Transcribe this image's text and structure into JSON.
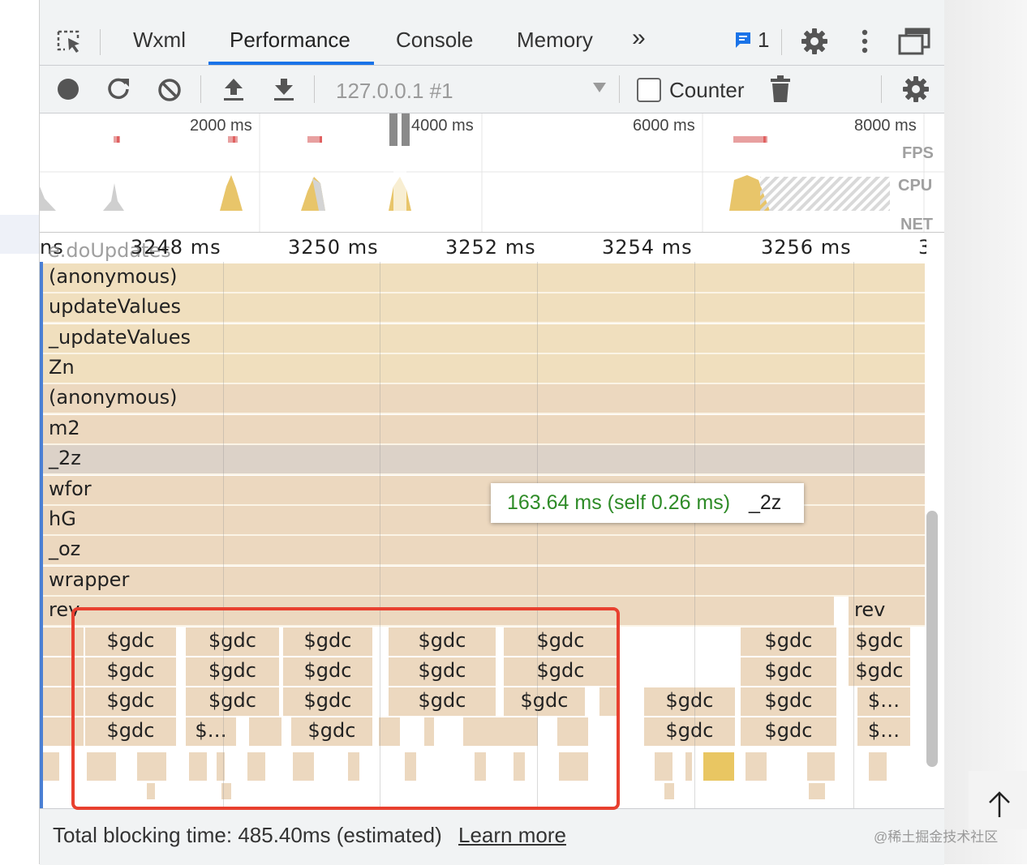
{
  "tabs": {
    "wxml": "Wxml",
    "performance": "Performance",
    "console": "Console",
    "memory": "Memory",
    "more": "»",
    "issues_count": "1"
  },
  "toolbar": {
    "target": "127.0.0.1 #1",
    "counter_label": "Counter"
  },
  "overview": {
    "time_labels": [
      "2000 ms",
      "4000 ms",
      "6000 ms",
      "8000 ms"
    ],
    "track_labels": [
      "FPS",
      "CPU",
      "NET"
    ]
  },
  "flamechart": {
    "ruler_labels": [
      "3248 ms",
      "3250 ms",
      "3252 ms",
      "3254 ms",
      "3256 ms",
      "3"
    ],
    "ruler_partial_left": "ns",
    "top_partial_row": "e.doUpdates",
    "rows": [
      "(anonymous)",
      "updateValues",
      "_updateValues",
      "Zn",
      "(anonymous)",
      "m2",
      "_2z",
      "wfor",
      "hG",
      "_oz",
      "wrapper",
      "rev"
    ],
    "rev_right": "rev",
    "gdc": "$gdc",
    "gdc_short": "$…"
  },
  "tooltip": {
    "time": "163.64 ms (self 0.26 ms)",
    "name": "_2z"
  },
  "footer": {
    "text": "Total blocking time: 485.40ms (estimated)",
    "link": "Learn more"
  },
  "watermark": "@稀土掘金技术社区",
  "colors": {
    "accent": "#1a73e8",
    "highlight": "#e8402f",
    "flame_yellow": "#f0dfbe",
    "flame_tan": "#ecd8bf",
    "selected_row": "#dcd2c8",
    "tooltip_time": "#2e8b27"
  }
}
